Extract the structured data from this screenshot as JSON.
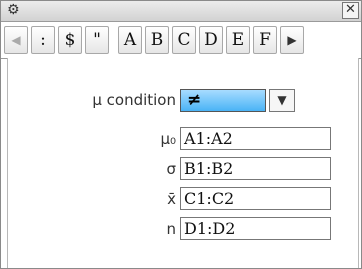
{
  "titlebar": {
    "settings_icon": "gear-icon",
    "close_label": "✕"
  },
  "toolbar": {
    "left_arrow": "◀",
    "keys": [
      ":",
      "$",
      "\"",
      "A",
      "B",
      "C",
      "D",
      "E",
      "F"
    ],
    "right_arrow": "▶"
  },
  "form": {
    "condition_label": "μ condition",
    "condition_value": "≠",
    "dropdown_arrow": "▼",
    "fields": [
      {
        "label": "μ₀",
        "value": "A1:A2"
      },
      {
        "label": "σ",
        "value": "B1:B2"
      },
      {
        "label": "x̄",
        "value": "C1:C2"
      },
      {
        "label": "n",
        "value": "D1:D2"
      }
    ]
  },
  "colors": {
    "accent": "#4ab3f6",
    "background": "#ffffff"
  }
}
